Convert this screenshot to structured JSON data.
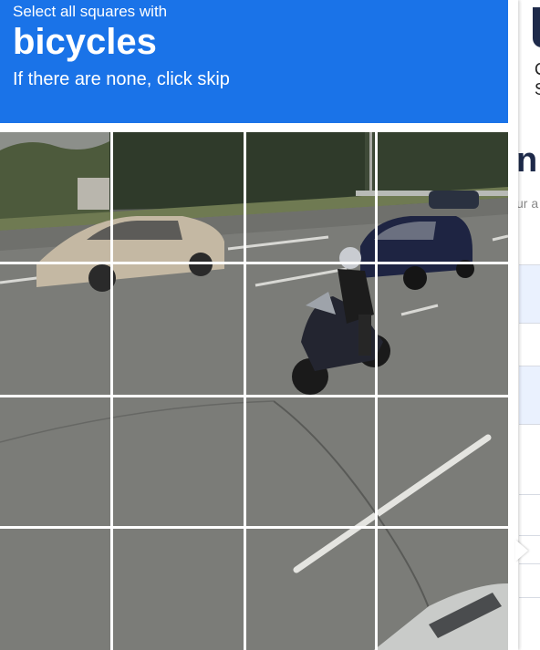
{
  "captcha": {
    "instruction": "Select all squares with",
    "target_object": "bicycles",
    "hint": "If there are none, click skip",
    "grid_rows": 4,
    "grid_cols": 4
  },
  "background_page": {
    "partial_text_1": "C",
    "partial_text_2": "S",
    "partial_heading": "n",
    "partial_subtext": "ur a"
  },
  "colors": {
    "header_bg": "#1a73e8",
    "header_text": "#ffffff"
  }
}
